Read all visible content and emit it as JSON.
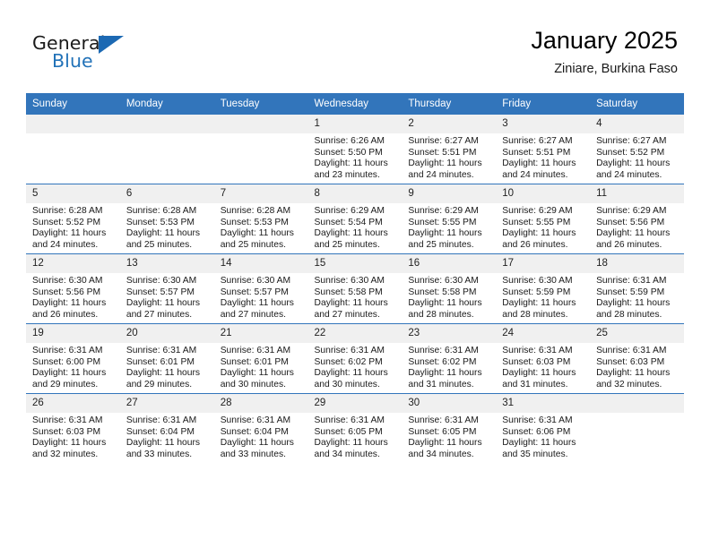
{
  "brand": {
    "name_top": "General",
    "name_bottom": "Blue",
    "accent_color": "#1c69b3"
  },
  "header": {
    "title": "January 2025",
    "subtitle": "Ziniare, Burkina Faso"
  },
  "calendar": {
    "header_bg": "#3275bb",
    "daycell_header_bg": "#f0f0f0",
    "weekday_headers": [
      "Sunday",
      "Monday",
      "Tuesday",
      "Wednesday",
      "Thursday",
      "Friday",
      "Saturday"
    ],
    "labels": {
      "sunrise_prefix": "Sunrise:",
      "sunset_prefix": "Sunset:",
      "daylight_prefix": "Daylight:"
    },
    "weeks": [
      [
        {
          "day": "",
          "blank": true,
          "sunrise": "",
          "sunset": "",
          "daylight_line1": "",
          "daylight_line2": ""
        },
        {
          "day": "",
          "blank": true,
          "sunrise": "",
          "sunset": "",
          "daylight_line1": "",
          "daylight_line2": ""
        },
        {
          "day": "",
          "blank": true,
          "sunrise": "",
          "sunset": "",
          "daylight_line1": "",
          "daylight_line2": ""
        },
        {
          "day": "1",
          "blank": false,
          "sunrise": "Sunrise: 6:26 AM",
          "sunset": "Sunset: 5:50 PM",
          "daylight_line1": "Daylight: 11 hours",
          "daylight_line2": "and 23 minutes."
        },
        {
          "day": "2",
          "blank": false,
          "sunrise": "Sunrise: 6:27 AM",
          "sunset": "Sunset: 5:51 PM",
          "daylight_line1": "Daylight: 11 hours",
          "daylight_line2": "and 24 minutes."
        },
        {
          "day": "3",
          "blank": false,
          "sunrise": "Sunrise: 6:27 AM",
          "sunset": "Sunset: 5:51 PM",
          "daylight_line1": "Daylight: 11 hours",
          "daylight_line2": "and 24 minutes."
        },
        {
          "day": "4",
          "blank": false,
          "sunrise": "Sunrise: 6:27 AM",
          "sunset": "Sunset: 5:52 PM",
          "daylight_line1": "Daylight: 11 hours",
          "daylight_line2": "and 24 minutes."
        }
      ],
      [
        {
          "day": "5",
          "blank": false,
          "sunrise": "Sunrise: 6:28 AM",
          "sunset": "Sunset: 5:52 PM",
          "daylight_line1": "Daylight: 11 hours",
          "daylight_line2": "and 24 minutes."
        },
        {
          "day": "6",
          "blank": false,
          "sunrise": "Sunrise: 6:28 AM",
          "sunset": "Sunset: 5:53 PM",
          "daylight_line1": "Daylight: 11 hours",
          "daylight_line2": "and 25 minutes."
        },
        {
          "day": "7",
          "blank": false,
          "sunrise": "Sunrise: 6:28 AM",
          "sunset": "Sunset: 5:53 PM",
          "daylight_line1": "Daylight: 11 hours",
          "daylight_line2": "and 25 minutes."
        },
        {
          "day": "8",
          "blank": false,
          "sunrise": "Sunrise: 6:29 AM",
          "sunset": "Sunset: 5:54 PM",
          "daylight_line1": "Daylight: 11 hours",
          "daylight_line2": "and 25 minutes."
        },
        {
          "day": "9",
          "blank": false,
          "sunrise": "Sunrise: 6:29 AM",
          "sunset": "Sunset: 5:55 PM",
          "daylight_line1": "Daylight: 11 hours",
          "daylight_line2": "and 25 minutes."
        },
        {
          "day": "10",
          "blank": false,
          "sunrise": "Sunrise: 6:29 AM",
          "sunset": "Sunset: 5:55 PM",
          "daylight_line1": "Daylight: 11 hours",
          "daylight_line2": "and 26 minutes."
        },
        {
          "day": "11",
          "blank": false,
          "sunrise": "Sunrise: 6:29 AM",
          "sunset": "Sunset: 5:56 PM",
          "daylight_line1": "Daylight: 11 hours",
          "daylight_line2": "and 26 minutes."
        }
      ],
      [
        {
          "day": "12",
          "blank": false,
          "sunrise": "Sunrise: 6:30 AM",
          "sunset": "Sunset: 5:56 PM",
          "daylight_line1": "Daylight: 11 hours",
          "daylight_line2": "and 26 minutes."
        },
        {
          "day": "13",
          "blank": false,
          "sunrise": "Sunrise: 6:30 AM",
          "sunset": "Sunset: 5:57 PM",
          "daylight_line1": "Daylight: 11 hours",
          "daylight_line2": "and 27 minutes."
        },
        {
          "day": "14",
          "blank": false,
          "sunrise": "Sunrise: 6:30 AM",
          "sunset": "Sunset: 5:57 PM",
          "daylight_line1": "Daylight: 11 hours",
          "daylight_line2": "and 27 minutes."
        },
        {
          "day": "15",
          "blank": false,
          "sunrise": "Sunrise: 6:30 AM",
          "sunset": "Sunset: 5:58 PM",
          "daylight_line1": "Daylight: 11 hours",
          "daylight_line2": "and 27 minutes."
        },
        {
          "day": "16",
          "blank": false,
          "sunrise": "Sunrise: 6:30 AM",
          "sunset": "Sunset: 5:58 PM",
          "daylight_line1": "Daylight: 11 hours",
          "daylight_line2": "and 28 minutes."
        },
        {
          "day": "17",
          "blank": false,
          "sunrise": "Sunrise: 6:30 AM",
          "sunset": "Sunset: 5:59 PM",
          "daylight_line1": "Daylight: 11 hours",
          "daylight_line2": "and 28 minutes."
        },
        {
          "day": "18",
          "blank": false,
          "sunrise": "Sunrise: 6:31 AM",
          "sunset": "Sunset: 5:59 PM",
          "daylight_line1": "Daylight: 11 hours",
          "daylight_line2": "and 28 minutes."
        }
      ],
      [
        {
          "day": "19",
          "blank": false,
          "sunrise": "Sunrise: 6:31 AM",
          "sunset": "Sunset: 6:00 PM",
          "daylight_line1": "Daylight: 11 hours",
          "daylight_line2": "and 29 minutes."
        },
        {
          "day": "20",
          "blank": false,
          "sunrise": "Sunrise: 6:31 AM",
          "sunset": "Sunset: 6:01 PM",
          "daylight_line1": "Daylight: 11 hours",
          "daylight_line2": "and 29 minutes."
        },
        {
          "day": "21",
          "blank": false,
          "sunrise": "Sunrise: 6:31 AM",
          "sunset": "Sunset: 6:01 PM",
          "daylight_line1": "Daylight: 11 hours",
          "daylight_line2": "and 30 minutes."
        },
        {
          "day": "22",
          "blank": false,
          "sunrise": "Sunrise: 6:31 AM",
          "sunset": "Sunset: 6:02 PM",
          "daylight_line1": "Daylight: 11 hours",
          "daylight_line2": "and 30 minutes."
        },
        {
          "day": "23",
          "blank": false,
          "sunrise": "Sunrise: 6:31 AM",
          "sunset": "Sunset: 6:02 PM",
          "daylight_line1": "Daylight: 11 hours",
          "daylight_line2": "and 31 minutes."
        },
        {
          "day": "24",
          "blank": false,
          "sunrise": "Sunrise: 6:31 AM",
          "sunset": "Sunset: 6:03 PM",
          "daylight_line1": "Daylight: 11 hours",
          "daylight_line2": "and 31 minutes."
        },
        {
          "day": "25",
          "blank": false,
          "sunrise": "Sunrise: 6:31 AM",
          "sunset": "Sunset: 6:03 PM",
          "daylight_line1": "Daylight: 11 hours",
          "daylight_line2": "and 32 minutes."
        }
      ],
      [
        {
          "day": "26",
          "blank": false,
          "sunrise": "Sunrise: 6:31 AM",
          "sunset": "Sunset: 6:03 PM",
          "daylight_line1": "Daylight: 11 hours",
          "daylight_line2": "and 32 minutes."
        },
        {
          "day": "27",
          "blank": false,
          "sunrise": "Sunrise: 6:31 AM",
          "sunset": "Sunset: 6:04 PM",
          "daylight_line1": "Daylight: 11 hours",
          "daylight_line2": "and 33 minutes."
        },
        {
          "day": "28",
          "blank": false,
          "sunrise": "Sunrise: 6:31 AM",
          "sunset": "Sunset: 6:04 PM",
          "daylight_line1": "Daylight: 11 hours",
          "daylight_line2": "and 33 minutes."
        },
        {
          "day": "29",
          "blank": false,
          "sunrise": "Sunrise: 6:31 AM",
          "sunset": "Sunset: 6:05 PM",
          "daylight_line1": "Daylight: 11 hours",
          "daylight_line2": "and 34 minutes."
        },
        {
          "day": "30",
          "blank": false,
          "sunrise": "Sunrise: 6:31 AM",
          "sunset": "Sunset: 6:05 PM",
          "daylight_line1": "Daylight: 11 hours",
          "daylight_line2": "and 34 minutes."
        },
        {
          "day": "31",
          "blank": false,
          "sunrise": "Sunrise: 6:31 AM",
          "sunset": "Sunset: 6:06 PM",
          "daylight_line1": "Daylight: 11 hours",
          "daylight_line2": "and 35 minutes."
        },
        {
          "day": "",
          "blank": true,
          "sunrise": "",
          "sunset": "",
          "daylight_line1": "",
          "daylight_line2": ""
        }
      ]
    ]
  }
}
